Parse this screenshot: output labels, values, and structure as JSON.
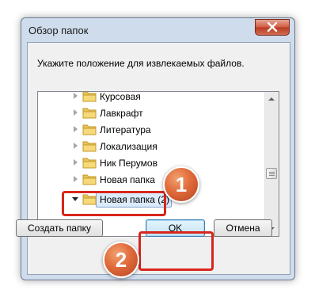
{
  "window": {
    "title": "Обзор папок"
  },
  "dialog": {
    "prompt": "Укажите положение для извлекаемых файлов."
  },
  "tree": {
    "items": [
      {
        "label": "Курсовая",
        "expanded": false,
        "selected": false
      },
      {
        "label": "Лавкрафт",
        "expanded": false,
        "selected": false
      },
      {
        "label": "Литература",
        "expanded": false,
        "selected": false
      },
      {
        "label": "Локализация",
        "expanded": false,
        "selected": false
      },
      {
        "label": "Ник Перумов",
        "expanded": false,
        "selected": false
      },
      {
        "label": "Новая папка",
        "expanded": false,
        "selected": false
      },
      {
        "label": "Новая папка (2)",
        "expanded": true,
        "selected": true
      }
    ]
  },
  "buttons": {
    "create": "Создать папку",
    "ok": "OK",
    "cancel": "Отмена"
  },
  "annotations": {
    "badge_1": "1",
    "badge_2": "2",
    "highlight_color": "#d8261c",
    "badge_color": "#e06a3a"
  },
  "icons": [
    "close-icon",
    "folder-icon",
    "expand-arrow-icon",
    "scroll-up-icon",
    "scroll-down-icon"
  ]
}
